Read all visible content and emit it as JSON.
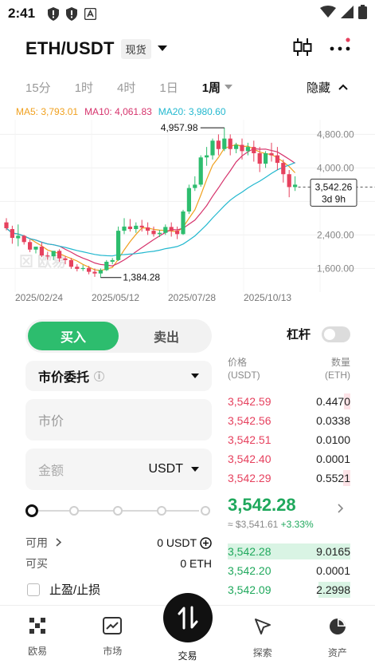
{
  "status_bar": {
    "time": "2:41"
  },
  "header": {
    "pair": "ETH/USDT",
    "badge": "现货"
  },
  "timeframes": {
    "items": [
      "15分",
      "1时",
      "4时",
      "1日"
    ],
    "active": "1周",
    "hide_label": "隐藏"
  },
  "ma": {
    "ma5": "MA5: 3,793.01",
    "ma10": "MA10: 4,061.83",
    "ma20": "MA20: 3,980.60"
  },
  "chart_data": {
    "type": "candlestick",
    "y_ticks": [
      "4,800.00",
      "4,000.00",
      "2,400.00",
      "1,600.00"
    ],
    "x_ticks": [
      "2025/02/24",
      "2025/05/12",
      "2025/07/28",
      "2025/10/13"
    ],
    "high_label": "4,957.98",
    "low_label": "1,384.28",
    "current_price": "3,542.26",
    "countdown": "3d 9h",
    "watermark": "欧易",
    "colors": {
      "up": "#2dbd6e",
      "down": "#e6415e",
      "ma5": "#f0a01e",
      "ma10": "#d6336c",
      "ma20": "#22b8cf"
    },
    "candles": [
      [
        2700,
        2800,
        2560,
        2510
      ],
      [
        2540,
        2620,
        2330,
        2190
      ],
      [
        2320,
        2650,
        2380,
        2130
      ],
      [
        2380,
        2400,
        2230,
        2170
      ],
      [
        2230,
        2290,
        2050,
        1990
      ],
      [
        2050,
        2100,
        2120,
        1960
      ],
      [
        2120,
        2230,
        1910,
        1870
      ],
      [
        1910,
        2000,
        1890,
        1810
      ],
      [
        1890,
        1990,
        2020,
        1800
      ],
      [
        2020,
        2060,
        1840,
        1760
      ],
      [
        1840,
        1900,
        1800,
        1700
      ],
      [
        1800,
        1850,
        1640,
        1590
      ],
      [
        1640,
        1700,
        1590,
        1530
      ],
      [
        1590,
        1680,
        1610,
        1540
      ],
      [
        1610,
        1660,
        1520,
        1460
      ],
      [
        1520,
        1600,
        1480,
        1400
      ],
      [
        1480,
        1600,
        1560,
        1384
      ],
      [
        1560,
        1800,
        1760,
        1540
      ],
      [
        1760,
        1850,
        1800,
        1700
      ],
      [
        1800,
        2600,
        2500,
        1780
      ],
      [
        2500,
        2800,
        2600,
        2420
      ],
      [
        2600,
        2780,
        2540,
        2480
      ],
      [
        2540,
        2700,
        2620,
        2450
      ],
      [
        2620,
        2760,
        2580,
        2480
      ],
      [
        2580,
        2700,
        2500,
        2400
      ],
      [
        2500,
        2600,
        2420,
        2360
      ],
      [
        2420,
        2520,
        2450,
        2350
      ],
      [
        2450,
        2650,
        2590,
        2400
      ],
      [
        2590,
        2700,
        2500,
        2360
      ],
      [
        2500,
        2600,
        2420,
        2300
      ],
      [
        2420,
        3000,
        2960,
        2400
      ],
      [
        2960,
        3600,
        3520,
        2900
      ],
      [
        3520,
        3800,
        3600,
        3450
      ],
      [
        3600,
        4300,
        4250,
        3550
      ],
      [
        4250,
        4500,
        4300,
        4050
      ],
      [
        4300,
        4700,
        4650,
        4200
      ],
      [
        4650,
        4800,
        4450,
        4300
      ],
      [
        4450,
        4957.98,
        4700,
        4400
      ],
      [
        4700,
        4800,
        4450,
        4300
      ],
      [
        4450,
        4600,
        4550,
        4350
      ],
      [
        4550,
        4700,
        4400,
        4200
      ],
      [
        4400,
        4600,
        4500,
        4300
      ],
      [
        4500,
        4650,
        4350,
        4150
      ],
      [
        4350,
        4500,
        4100,
        3900
      ],
      [
        4100,
        4400,
        4350,
        4000
      ],
      [
        4350,
        4600,
        4300,
        4150
      ],
      [
        4300,
        4500,
        4120,
        3950
      ],
      [
        4120,
        4200,
        3850,
        3650
      ],
      [
        3850,
        3950,
        3542.26,
        3300
      ],
      [
        3542.26,
        3800,
        3600,
        3450
      ]
    ]
  },
  "order_form": {
    "buy_label": "买入",
    "sell_label": "卖出",
    "leverage_label": "杠杆",
    "order_type": "市价委托",
    "price_placeholder": "市价",
    "amount_placeholder": "金额",
    "amount_unit": "USDT",
    "available_label": "可用",
    "available_value": "0 USDT",
    "can_buy_label": "可买",
    "can_buy_value": "0 ETH",
    "tpsl_label": "止盈/止损"
  },
  "order_book": {
    "price_header": "价格",
    "price_unit": "(USDT)",
    "qty_header": "数量",
    "qty_unit": "(ETH)",
    "asks": [
      {
        "price": "3,542.59",
        "qty": "0.4470",
        "depth": 0.05
      },
      {
        "price": "3,542.56",
        "qty": "0.0338",
        "depth": 0.0
      },
      {
        "price": "3,542.51",
        "qty": "0.0100",
        "depth": 0.0
      },
      {
        "price": "3,542.40",
        "qty": "0.0001",
        "depth": 0.0
      },
      {
        "price": "3,542.29",
        "qty": "0.5521",
        "depth": 0.06
      }
    ],
    "last_price": "3,542.28",
    "last_usd": "≈ $3,541.61",
    "last_change": "+3.33%",
    "bids": [
      {
        "price": "3,542.28",
        "qty": "9.0165",
        "depth": 1.0
      },
      {
        "price": "3,542.20",
        "qty": "0.0001",
        "depth": 0.0
      },
      {
        "price": "3,542.09",
        "qty": "2.2998",
        "depth": 0.26
      }
    ]
  },
  "nav": {
    "home": "欧易",
    "market": "市场",
    "trade": "交易",
    "explore": "探索",
    "assets": "资产"
  }
}
